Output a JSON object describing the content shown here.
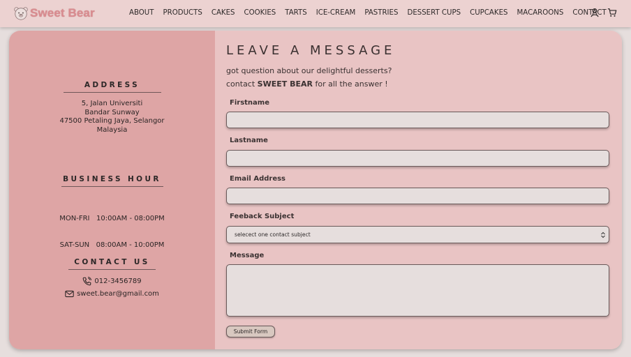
{
  "brand": {
    "name": "Sweet Bear",
    "color": "#d98c90"
  },
  "nav": {
    "items": [
      "ABOUT",
      "PRODUCTS",
      "CAKES",
      "COOKIES",
      "TARTS",
      "ICE-CREAM",
      "PASTRIES",
      "DESSERT CUPS",
      "CUPCAKES",
      "MACAROONS",
      "CONTACT"
    ],
    "icons": [
      "user-icon",
      "cart-icon"
    ]
  },
  "info": {
    "address": {
      "heading": "ADDRESS",
      "lines": [
        "5, Jalan Universiti",
        "Bandar Sunway",
        "47500 Petaling Jaya, Selangor",
        "Malaysia"
      ]
    },
    "hours": {
      "heading": "BUSINESS HOUR",
      "lines": [
        "MON-FRI   10:00AM - 08:00PM",
        "SAT-SUN   08:00AM - 10:00PM"
      ]
    },
    "contact": {
      "heading": "CONTACT US",
      "phone": "012-3456789",
      "email": "sweet.bear@gmail.com"
    }
  },
  "form": {
    "title": "LEAVE A MESSAGE",
    "intro_line1": "got question about our delightful desserts?",
    "intro_line2_pre": "contact ",
    "intro_line2_bold": "SWEET BEAR",
    "intro_line2_post": " for all the answer !",
    "firstname_label": "Firstname",
    "lastname_label": "Lastname",
    "email_label": "Email Address",
    "subject_label": "Feeback Subject",
    "subject_value": "selecect one contact subject",
    "message_label": "Message",
    "submit_label": "Submit Form"
  },
  "colors": {
    "nav_bg": "#ecd2d1",
    "info_bg": "#dea5a5",
    "form_bg": "#e9c4c4",
    "input_bg": "#e6dedd"
  }
}
